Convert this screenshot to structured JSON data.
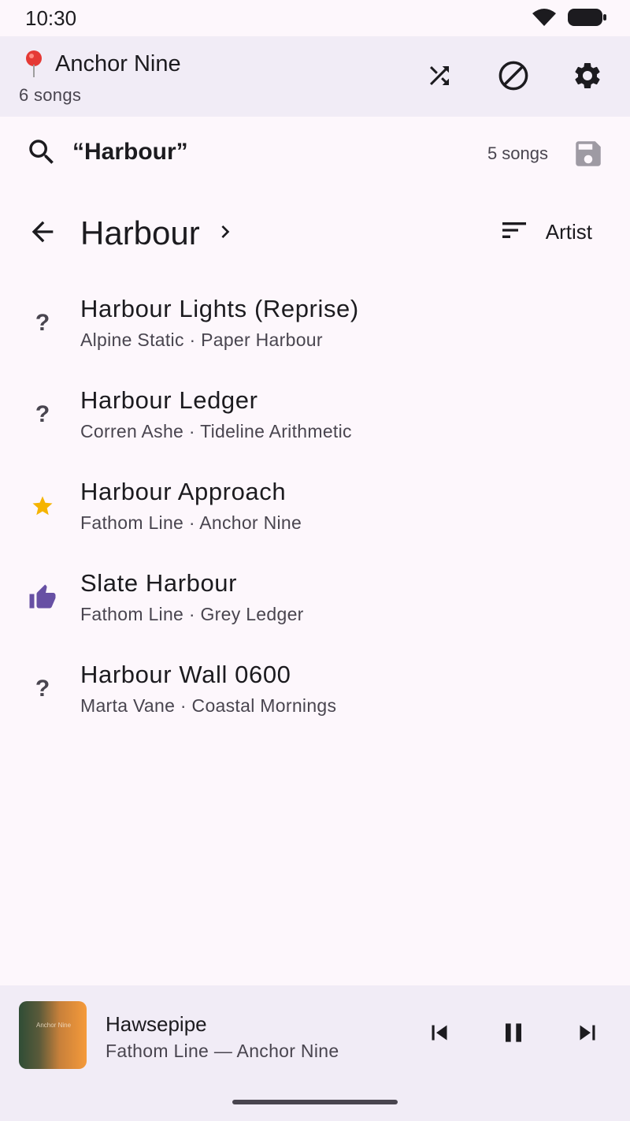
{
  "status_bar": {
    "time": "10:30"
  },
  "header": {
    "pin_icon": "map-pin-icon",
    "title": "Anchor Nine",
    "subtitle": "6 songs",
    "actions": [
      {
        "icon": "shuffle-icon"
      },
      {
        "icon": "block-icon"
      },
      {
        "icon": "settings-icon"
      }
    ]
  },
  "search": {
    "query": "“Harbour”",
    "result_count": "5 songs",
    "save_icon": "save-icon"
  },
  "nav": {
    "title": "Harbour",
    "sort_label": "Artist"
  },
  "songs": [
    {
      "title": "Harbour Lights (Reprise)",
      "subtitle": "Alpine Static · Paper Harbour",
      "status": "unknown",
      "glyph": "?"
    },
    {
      "title": "Harbour Ledger",
      "subtitle": "Corren Ashe · Tideline Arithmetic",
      "status": "unknown",
      "glyph": "?"
    },
    {
      "title": "Harbour Approach",
      "subtitle": "Fathom Line · Anchor Nine",
      "status": "starred",
      "glyph": ""
    },
    {
      "title": "Slate Harbour",
      "subtitle": "Fathom Line · Grey Ledger",
      "status": "liked",
      "glyph": ""
    },
    {
      "title": "Harbour Wall 0600",
      "subtitle": "Marta Vane · Coastal Mornings",
      "status": "unknown",
      "glyph": "?"
    }
  ],
  "player": {
    "art_text": "Anchor Nine",
    "title": "Hawsepipe",
    "subtitle": "Fathom Line — Anchor Nine",
    "controls": [
      "skip-previous-icon",
      "pause-icon",
      "skip-next-icon"
    ]
  },
  "colors": {
    "background": "#fdf7fc",
    "header_bg": "#f1ecf6",
    "star": "#f5b400",
    "thumb": "#6750a4",
    "pin": "#e53935"
  }
}
